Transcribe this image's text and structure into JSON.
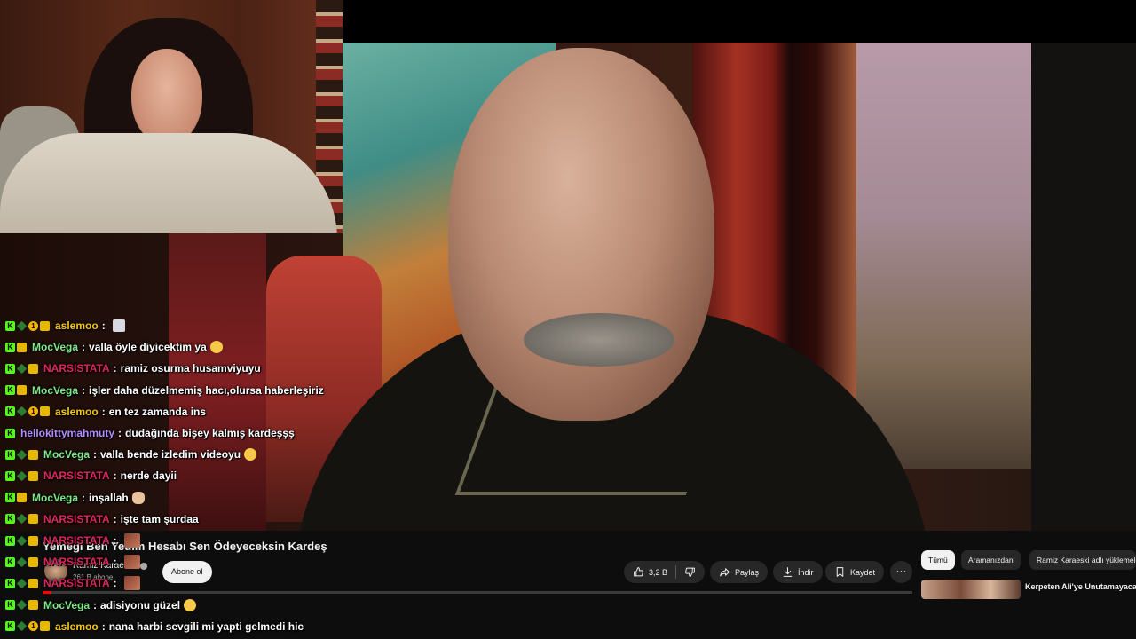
{
  "video": {
    "title": "Yemeği Ben Yedim Hesabı Sen Ödeyeceksin Kardeş",
    "channel": "Ramiz Karaeski",
    "subscribers": "261 B abone",
    "subscribe_label": "Abone ol",
    "likes": "3,2 B",
    "share_label": "Paylaş",
    "download_label": "İndir",
    "save_label": "Kaydet",
    "more_label": "···",
    "progress": 0.01
  },
  "recommendations": {
    "chips": [
      "Tümü",
      "Aramanızdan",
      "Ramiz Karaeski adlı yüklemeler"
    ],
    "first_title": "Kerpeten Ali'ye Unutamayacağı Portakal Dayağı"
  },
  "chat": [
    {
      "badges": [
        "k",
        "d",
        "1",
        "c"
      ],
      "user": "aslemoo",
      "color": "#f5c518",
      "text": "",
      "emote": "box"
    },
    {
      "badges": [
        "k",
        "c"
      ],
      "user": "MocVega",
      "color": "#7ee787",
      "text": "valla öyle diyicektim ya",
      "emote": "smile"
    },
    {
      "badges": [
        "k",
        "d",
        "c"
      ],
      "user": "NARSISTATA",
      "color": "#e0245e",
      "text": "ramiz osurma husamviyuyu",
      "emote": ""
    },
    {
      "badges": [
        "k",
        "c"
      ],
      "user": "MocVega",
      "color": "#7ee787",
      "text": "işler daha düzelmemiş hacı,olursa haberleşiriz",
      "emote": ""
    },
    {
      "badges": [
        "k",
        "d",
        "1",
        "c"
      ],
      "user": "aslemoo",
      "color": "#f5c518",
      "text": "en tez zamanda ins",
      "emote": ""
    },
    {
      "badges": [
        "k"
      ],
      "user": "hellokittymahmuty",
      "color": "#b48cff",
      "text": "dudağında bişey kalmış kardeşşş",
      "emote": ""
    },
    {
      "badges": [
        "k",
        "d",
        "c"
      ],
      "user": "MocVega",
      "color": "#7ee787",
      "text": "valla bende izledim videoyu",
      "emote": "smile"
    },
    {
      "badges": [
        "k",
        "d",
        "c"
      ],
      "user": "NARSISTATA",
      "color": "#e0245e",
      "text": "nerde dayii",
      "emote": ""
    },
    {
      "badges": [
        "k",
        "c"
      ],
      "user": "MocVega",
      "color": "#7ee787",
      "text": "inşallah",
      "emote": "hands"
    },
    {
      "badges": [
        "k",
        "d",
        "c"
      ],
      "user": "NARSISTATA",
      "color": "#e0245e",
      "text": "işte tam şurdaa",
      "emote": ""
    },
    {
      "badges": [
        "k",
        "d",
        "c"
      ],
      "user": "NARSISTATA",
      "color": "#e0245e",
      "text": "",
      "emote": "pic"
    },
    {
      "badges": [
        "k",
        "d",
        "c"
      ],
      "user": "NARSISTATA",
      "color": "#e0245e",
      "text": "",
      "emote": "pic"
    },
    {
      "badges": [
        "k",
        "d",
        "c"
      ],
      "user": "NARSISTATA",
      "color": "#e0245e",
      "text": "",
      "emote": "pic"
    },
    {
      "badges": [
        "k",
        "d",
        "c"
      ],
      "user": "MocVega",
      "color": "#7ee787",
      "text": "adisiyonu güzel",
      "emote": "smile"
    },
    {
      "badges": [
        "k",
        "d",
        "1",
        "c"
      ],
      "user": "aslemoo",
      "color": "#f5c518",
      "text": "nana harbi sevgili mi yapti gelmedi hic",
      "emote": ""
    }
  ]
}
